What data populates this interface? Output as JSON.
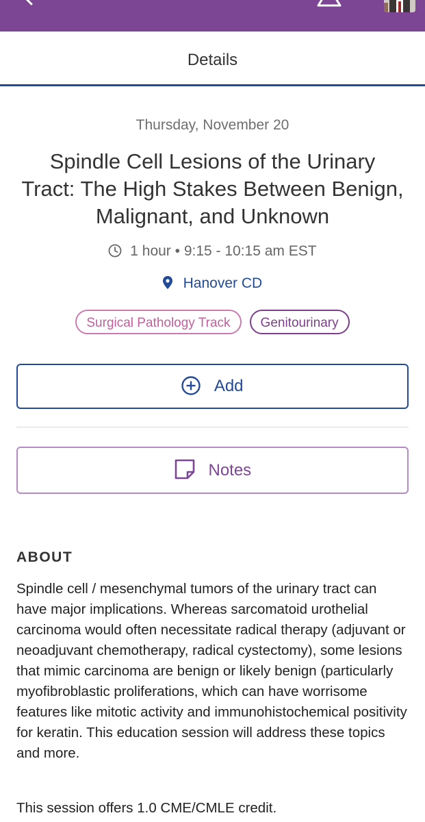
{
  "colors": {
    "topbar": "#7d4694",
    "accent_blue": "#234a97",
    "track_tag": "#c0609e",
    "topic_tag": "#7d3f8c",
    "notes": "#7d4694"
  },
  "topbar": {
    "icons": [
      "back-arrow-icon",
      "bell-icon",
      "avatar"
    ]
  },
  "header": {
    "title": "Details"
  },
  "session": {
    "date": "Thursday, November 20",
    "title": "Spindle Cell Lesions of the Urinary Tract: The High Stakes Between Benign, Malignant, and Unknown",
    "time": "1 hour • 9:15 - 10:15 am EST",
    "time_icon": "clock-icon",
    "location": "Hanover CD",
    "location_icon": "map-pin-icon",
    "tags": [
      "Surgical Pathology Track",
      "Genitourinary"
    ]
  },
  "actions": {
    "add_label": "Add",
    "add_icon": "plus-circle-icon",
    "notes_label": "Notes",
    "notes_icon": "note-icon"
  },
  "about": {
    "heading": "ABOUT",
    "body": "Spindle cell / mesenchymal tumors of the urinary tract can have major implications. Whereas sarcomatoid urothelial carcinoma would often necessitate radical therapy (adjuvant or neoadjuvant chemotherapy, radical cystectomy), some lesions that mimic carcinoma are benign or likely benign (particularly myofibroblastic proliferations, which can have worrisome features like mitotic activity and immunohistochemical positivity for keratin. This education session will address these topics and more.",
    "credit": "This session offers 1.0 CME/CMLE credit."
  }
}
